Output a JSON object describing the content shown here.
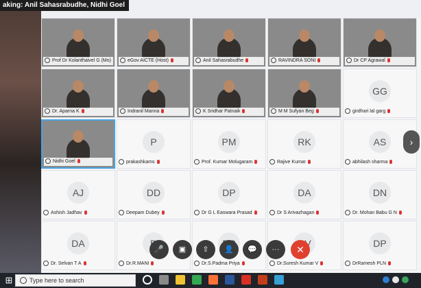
{
  "speaking": {
    "prefix": "aking:",
    "names": "Anil Sahasrabudhe, Nidhi Goel"
  },
  "participants": [
    {
      "name": "Prof Dr Kolanthaivel G (Mo)",
      "video": true
    },
    {
      "name": "eGov AICTE (Host)",
      "video": true
    },
    {
      "name": "Anil Sahasrabudhe",
      "video": true
    },
    {
      "name": "RAVINDRA SONI",
      "video": true
    },
    {
      "name": "Dr CP Agrawal",
      "video": true
    },
    {
      "name": "Dr. Aparna K",
      "video": true
    },
    {
      "name": "Indranil Manna",
      "video": true
    },
    {
      "name": "K Sridhar Patnaik",
      "video": true
    },
    {
      "name": "M M Sufyan Beg",
      "video": true
    },
    {
      "name": "girdhari lal garg",
      "initials": "GG"
    },
    {
      "name": "Nidhi Goel",
      "video": true,
      "active": true
    },
    {
      "name": "prakashkams",
      "initials": "P"
    },
    {
      "name": "Prof. Kumar Molugaram",
      "initials": "PM"
    },
    {
      "name": "Rajive Kumar",
      "initials": "RK"
    },
    {
      "name": "abhilash sharma",
      "initials": "AS"
    },
    {
      "name": "Ashish Jadhav",
      "initials": "AJ"
    },
    {
      "name": "Deepam Dubey",
      "initials": "DD"
    },
    {
      "name": "Dr G L Easwara Prasad",
      "initials": "DP"
    },
    {
      "name": "Dr S Arivazhagan",
      "initials": "DA"
    },
    {
      "name": "Dr. Mohan Babu G N",
      "initials": "DN"
    },
    {
      "name": "Dr. Selvan T A",
      "initials": "DA"
    },
    {
      "name": "Dr.R.MANI",
      "initials": "D"
    },
    {
      "name": "Dr.S.Padma Priya",
      "initials": "DP"
    },
    {
      "name": "Dr.Suresh Kumar V",
      "initials": "DV"
    },
    {
      "name": "DrRamesh PLN",
      "initials": "DP"
    }
  ],
  "nav": {
    "next_label": "›"
  },
  "controls": {
    "mic_label": "🎤",
    "video_label": "▣",
    "share_label": "⇧",
    "participants_label": "👤",
    "chat_label": "💬",
    "more_label": "···",
    "hangup_label": "✕"
  },
  "taskbar": {
    "start_label": "⊞",
    "search_placeholder": "Type here to search",
    "icons": [
      "cortana-icon",
      "task-view-icon",
      "file-explorer-icon",
      "chrome-icon",
      "firefox-icon",
      "word-icon",
      "acrobat-icon",
      "powerpoint-icon",
      "webex-icon"
    ]
  }
}
